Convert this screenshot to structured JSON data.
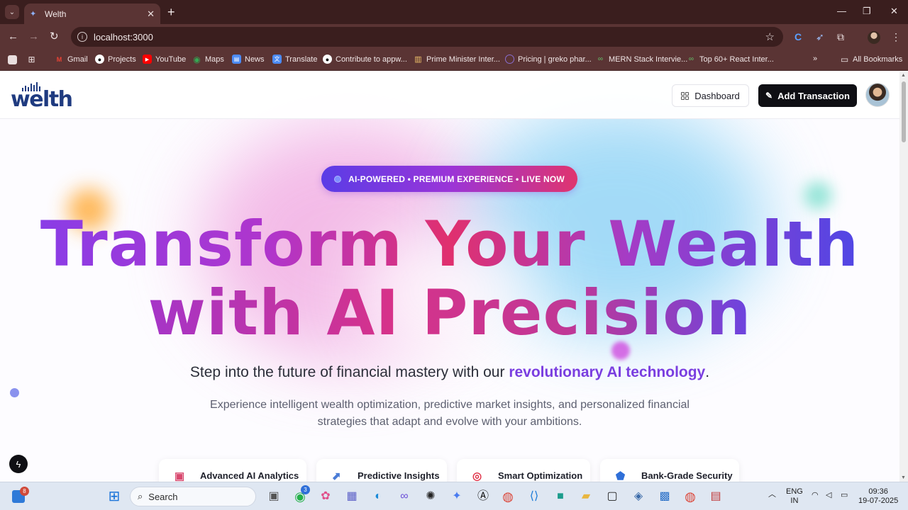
{
  "browser": {
    "tab_title": "Welth",
    "url": "localhost:3000",
    "bookmarks": [
      {
        "label": "Gmail",
        "color": "#ea4335"
      },
      {
        "label": "Projects",
        "color": "#ffffff"
      },
      {
        "label": "YouTube",
        "color": "#ff0000"
      },
      {
        "label": "Maps",
        "color": "#34a853"
      },
      {
        "label": "News",
        "color": "#4c8bf5"
      },
      {
        "label": "Translate",
        "color": "#4c8bf5"
      },
      {
        "label": "Contribute to appw...",
        "color": "#ffffff"
      },
      {
        "label": "Prime Minister Inter...",
        "color": "#f0c26b"
      },
      {
        "label": "Pricing | greko phar...",
        "color": "#8a6ed0"
      },
      {
        "label": "MERN Stack Intervie...",
        "color": "#64c46b"
      },
      {
        "label": "Top 60+ React Inter...",
        "color": "#64c46b"
      }
    ],
    "all_bookmarks": "All Bookmarks"
  },
  "site": {
    "logo_text": "welth",
    "dashboard_label": "Dashboard",
    "add_transaction_label": "Add Transaction"
  },
  "hero": {
    "badge": "AI-POWERED • PREMIUM EXPERIENCE • LIVE NOW",
    "headline_line1": "Transform Your Wealth",
    "headline_line2": "with AI Precision",
    "subtitle_prefix": "Step into the future of financial mastery with our ",
    "subtitle_accent": "revolutionary AI technology",
    "subtitle_suffix": ".",
    "description": "Experience intelligent wealth optimization, predictive market insights, and personalized financial strategies that adapt and evolve with your ambitions.",
    "features": [
      {
        "label": "Advanced AI Analytics",
        "icon": "robot-icon"
      },
      {
        "label": "Predictive Insights",
        "icon": "trend-chart-icon"
      },
      {
        "label": "Smart Optimization",
        "icon": "target-icon"
      },
      {
        "label": "Bank-Grade Security",
        "icon": "shield-icon"
      }
    ]
  },
  "taskbar": {
    "search_label": "Search",
    "widgets_badge": "8",
    "whatsapp_badge": "3",
    "lang_line1": "ENG",
    "lang_line2": "IN",
    "time": "09:36",
    "date": "19-07-2025"
  },
  "colors": {
    "brand_navy": "#1f3b80",
    "accent_purple": "#7a3ee0",
    "accent_pink": "#e0306e",
    "browser_frame": "#5a3434"
  }
}
